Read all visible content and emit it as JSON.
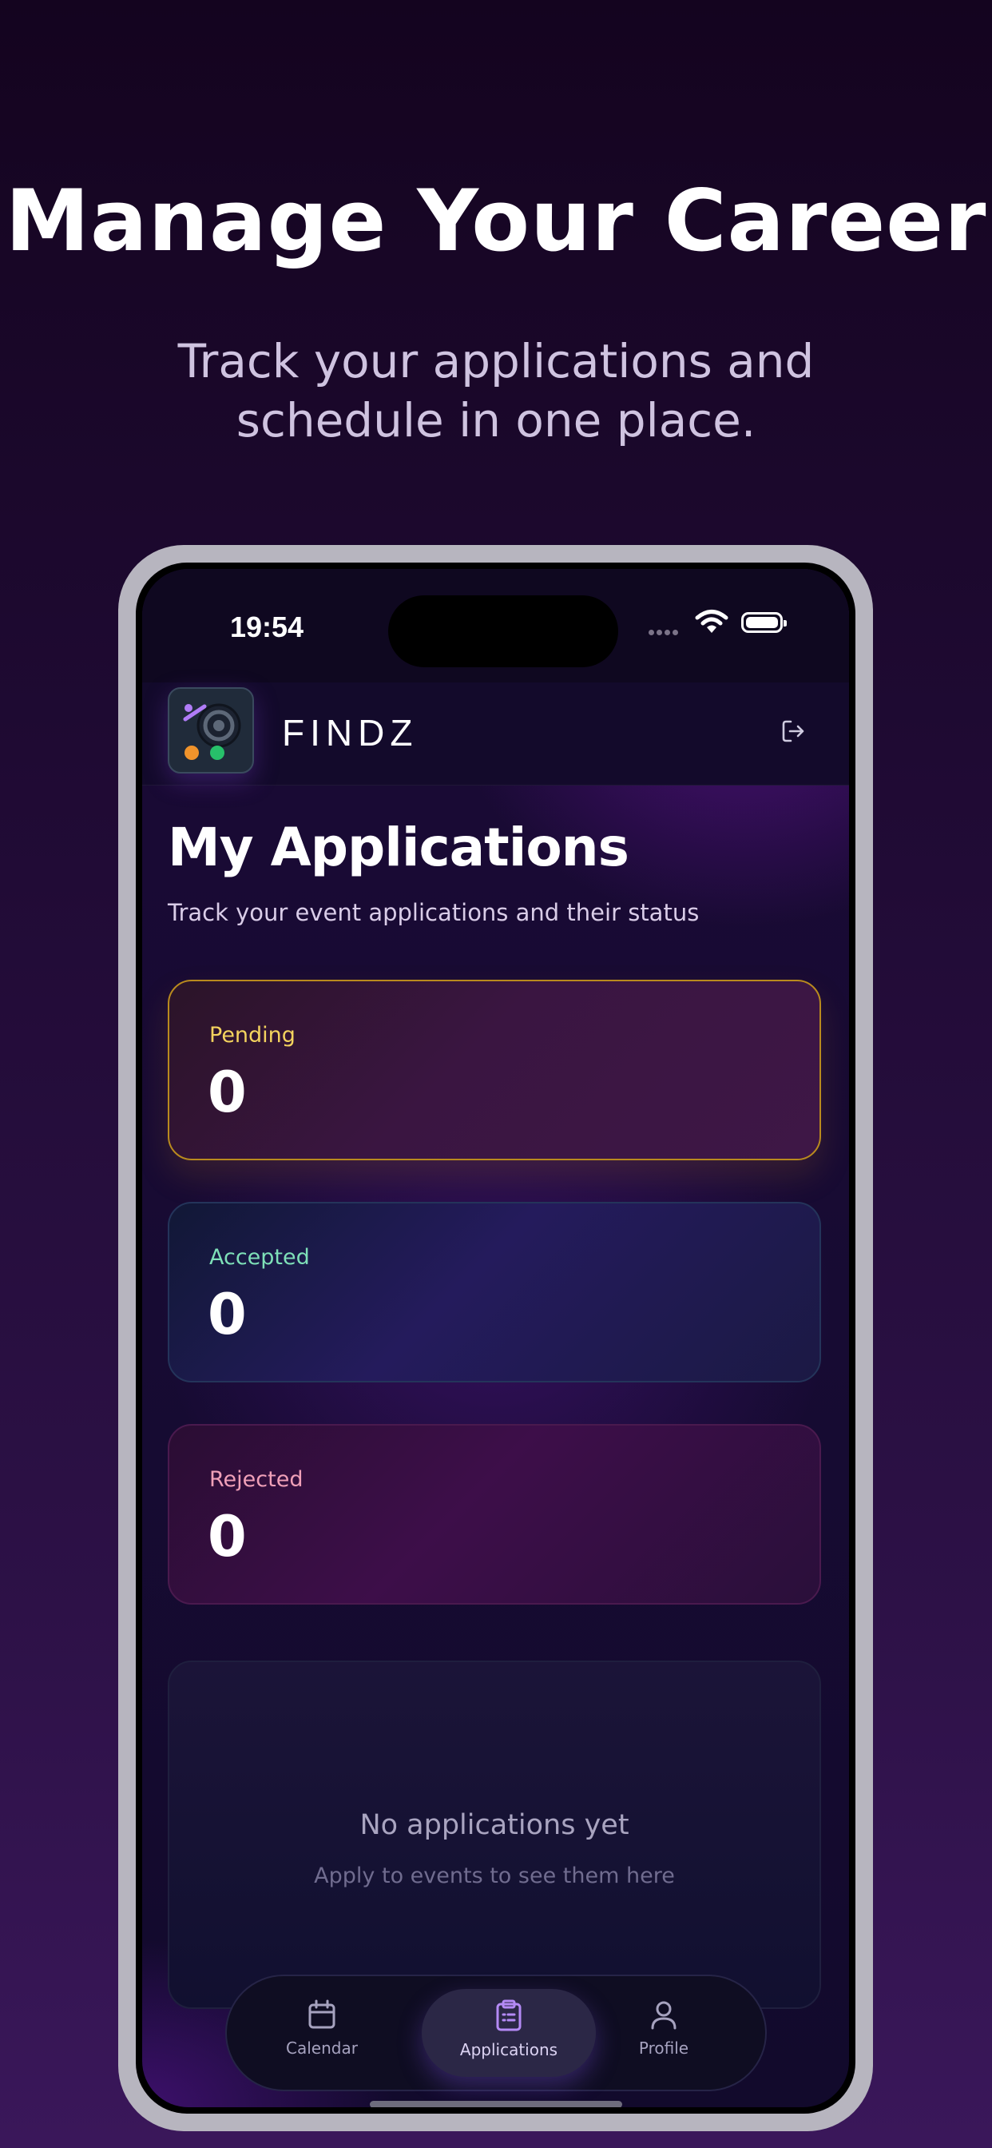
{
  "promo": {
    "title": "Manage Your Career",
    "subtitle": "Track your applications and schedule in one place."
  },
  "status_bar": {
    "time": "19:54",
    "icons": [
      "signal-icon",
      "wifi-icon",
      "battery-icon"
    ]
  },
  "header": {
    "brand": "FINDZ",
    "logo_icon": "app-logo",
    "logout_icon": "logout-icon"
  },
  "page": {
    "title": "My Applications",
    "subtitle": "Track your event applications and their status"
  },
  "stats": [
    {
      "label": "Pending",
      "value": "0",
      "color": "#f4d35e"
    },
    {
      "label": "Accepted",
      "value": "0",
      "color": "#7ee0b8"
    },
    {
      "label": "Rejected",
      "value": "0",
      "color": "#f0a0b8"
    }
  ],
  "empty_state": {
    "title": "No applications yet",
    "subtitle": "Apply to events to see them here"
  },
  "tabs": [
    {
      "label": "Calendar",
      "icon": "calendar-icon",
      "active": false
    },
    {
      "label": "Applications",
      "icon": "clipboard-icon",
      "active": true
    },
    {
      "label": "Profile",
      "icon": "person-icon",
      "active": false
    }
  ],
  "colors": {
    "accent": "#a77bf0",
    "background": "#14041f",
    "pending_border": "#b98a1e"
  }
}
